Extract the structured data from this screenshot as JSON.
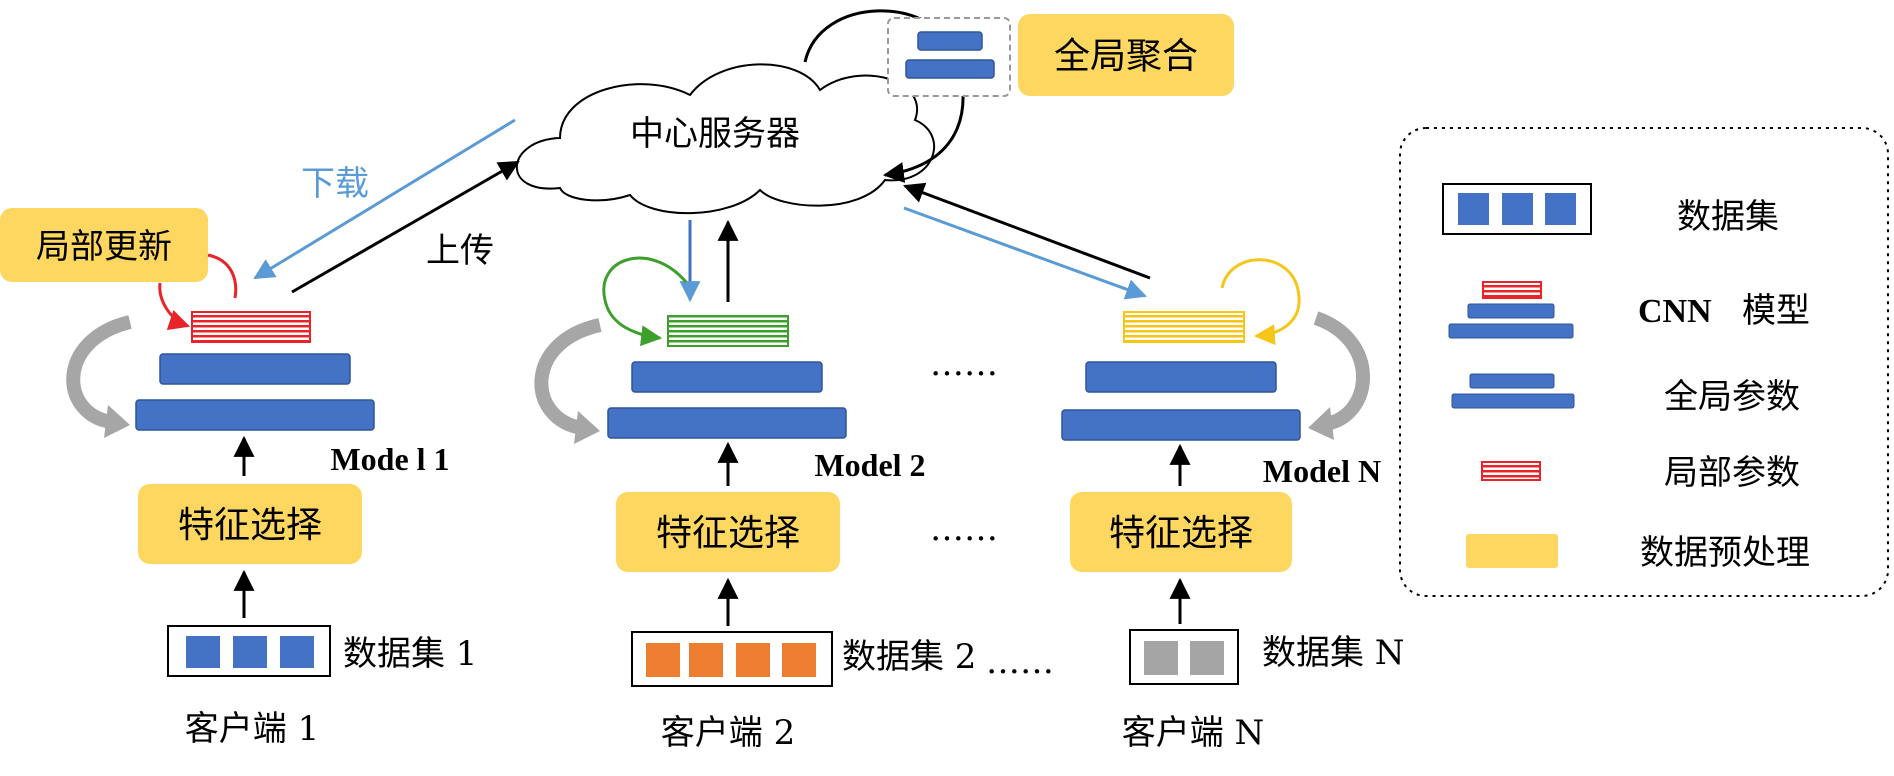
{
  "server": {
    "label": "中心服务器"
  },
  "global_aggregation": {
    "label": "全局聚合"
  },
  "arrows": {
    "download": "下载",
    "upload": "上传"
  },
  "local_update": {
    "label": "局部更新"
  },
  "clients": [
    {
      "model": "Mode l 1",
      "feature": "特征选择",
      "dataset": "数据集 1",
      "client": "客户端 1"
    },
    {
      "model": "Model 2",
      "feature": "特征选择",
      "dataset": "数据集 2",
      "client": "客户端 2"
    },
    {
      "model": "Model N",
      "feature": "特征选择",
      "dataset": "数据集 N",
      "client": "客户端 N"
    }
  ],
  "ellipsis": "……",
  "legend": {
    "dataset": "数据集",
    "cnn_prefix": "CNN",
    "cnn_suffix": "模型",
    "global_params": "全局参数",
    "local_params": "局部参数",
    "preprocess": "数据预处理"
  },
  "colors": {
    "blue": "#4472c4",
    "yellow": "#fdd760",
    "red": "#e8242a",
    "green": "#3da02c",
    "gold": "#f5c518",
    "orange": "#ed7d31",
    "gray": "#a5a5a5",
    "download_arrow": "#5b9bd5"
  }
}
